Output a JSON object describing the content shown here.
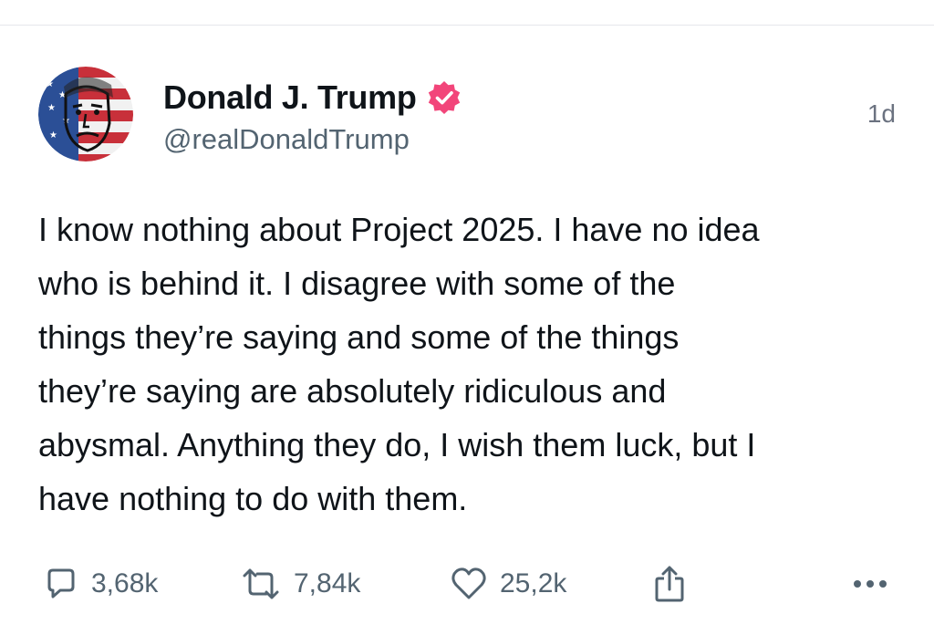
{
  "post": {
    "author": {
      "display_name": "Donald J. Trump",
      "handle": "@realDonaldTrump",
      "avatar_icon": "flag-portrait-avatar",
      "verified_icon": "verified-badge-icon",
      "verified_color": "#f2457a"
    },
    "timestamp": "1d",
    "text": "I know nothing about Project 2025. I have no idea\nwho is behind it. I disagree with some of the\nthings they’re saying and some of the things\nthey’re saying are absolutely ridiculous and\nabysmal. Anything they do, I wish them luck, but I\nhave nothing to do with them.",
    "actions": {
      "reply": {
        "icon": "reply-icon",
        "count": "3,68k"
      },
      "repost": {
        "icon": "repost-icon",
        "count": "7,84k"
      },
      "like": {
        "icon": "heart-icon",
        "count": "25,2k"
      },
      "share": {
        "icon": "share-icon"
      },
      "more": {
        "icon": "more-icon"
      }
    }
  },
  "colors": {
    "text_primary": "#0f1419",
    "text_secondary": "#536471",
    "divider": "#e5e7eb"
  }
}
